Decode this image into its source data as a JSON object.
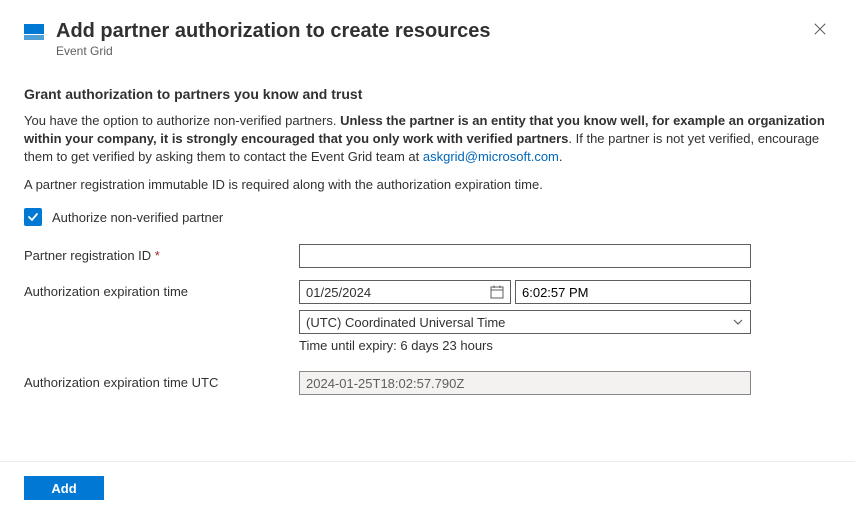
{
  "header": {
    "title": "Add partner authorization to create resources",
    "subtitle": "Event Grid"
  },
  "section": {
    "heading": "Grant authorization to partners you know and trust",
    "intro_text_plain": "You have the option to authorize non-verified partners. ",
    "intro_text_bold": "Unless the partner is an entity that you know well, for example an organization within your company, it is strongly encouraged that you only work with verified partners",
    "intro_text_after": ". If the partner is not yet verified, encourage them to get verified by asking them to contact the Event Grid team at ",
    "contact_email": "askgrid@microsoft.com",
    "intro_text_end": ".",
    "requirement_text": "A partner registration immutable ID is required along with the authorization expiration time."
  },
  "checkbox": {
    "label": "Authorize non-verified partner",
    "checked": true
  },
  "fields": {
    "registration_id": {
      "label": "Partner registration ID",
      "required": "*",
      "value": ""
    },
    "expiration": {
      "label": "Authorization expiration time",
      "date": "01/25/2024",
      "time": "6:02:57 PM",
      "timezone": "(UTC) Coordinated Universal Time",
      "helper": "Time until expiry: 6 days 23 hours"
    },
    "expiration_utc": {
      "label": "Authorization expiration time UTC",
      "value": "2024-01-25T18:02:57.790Z"
    }
  },
  "footer": {
    "add_button": "Add"
  }
}
